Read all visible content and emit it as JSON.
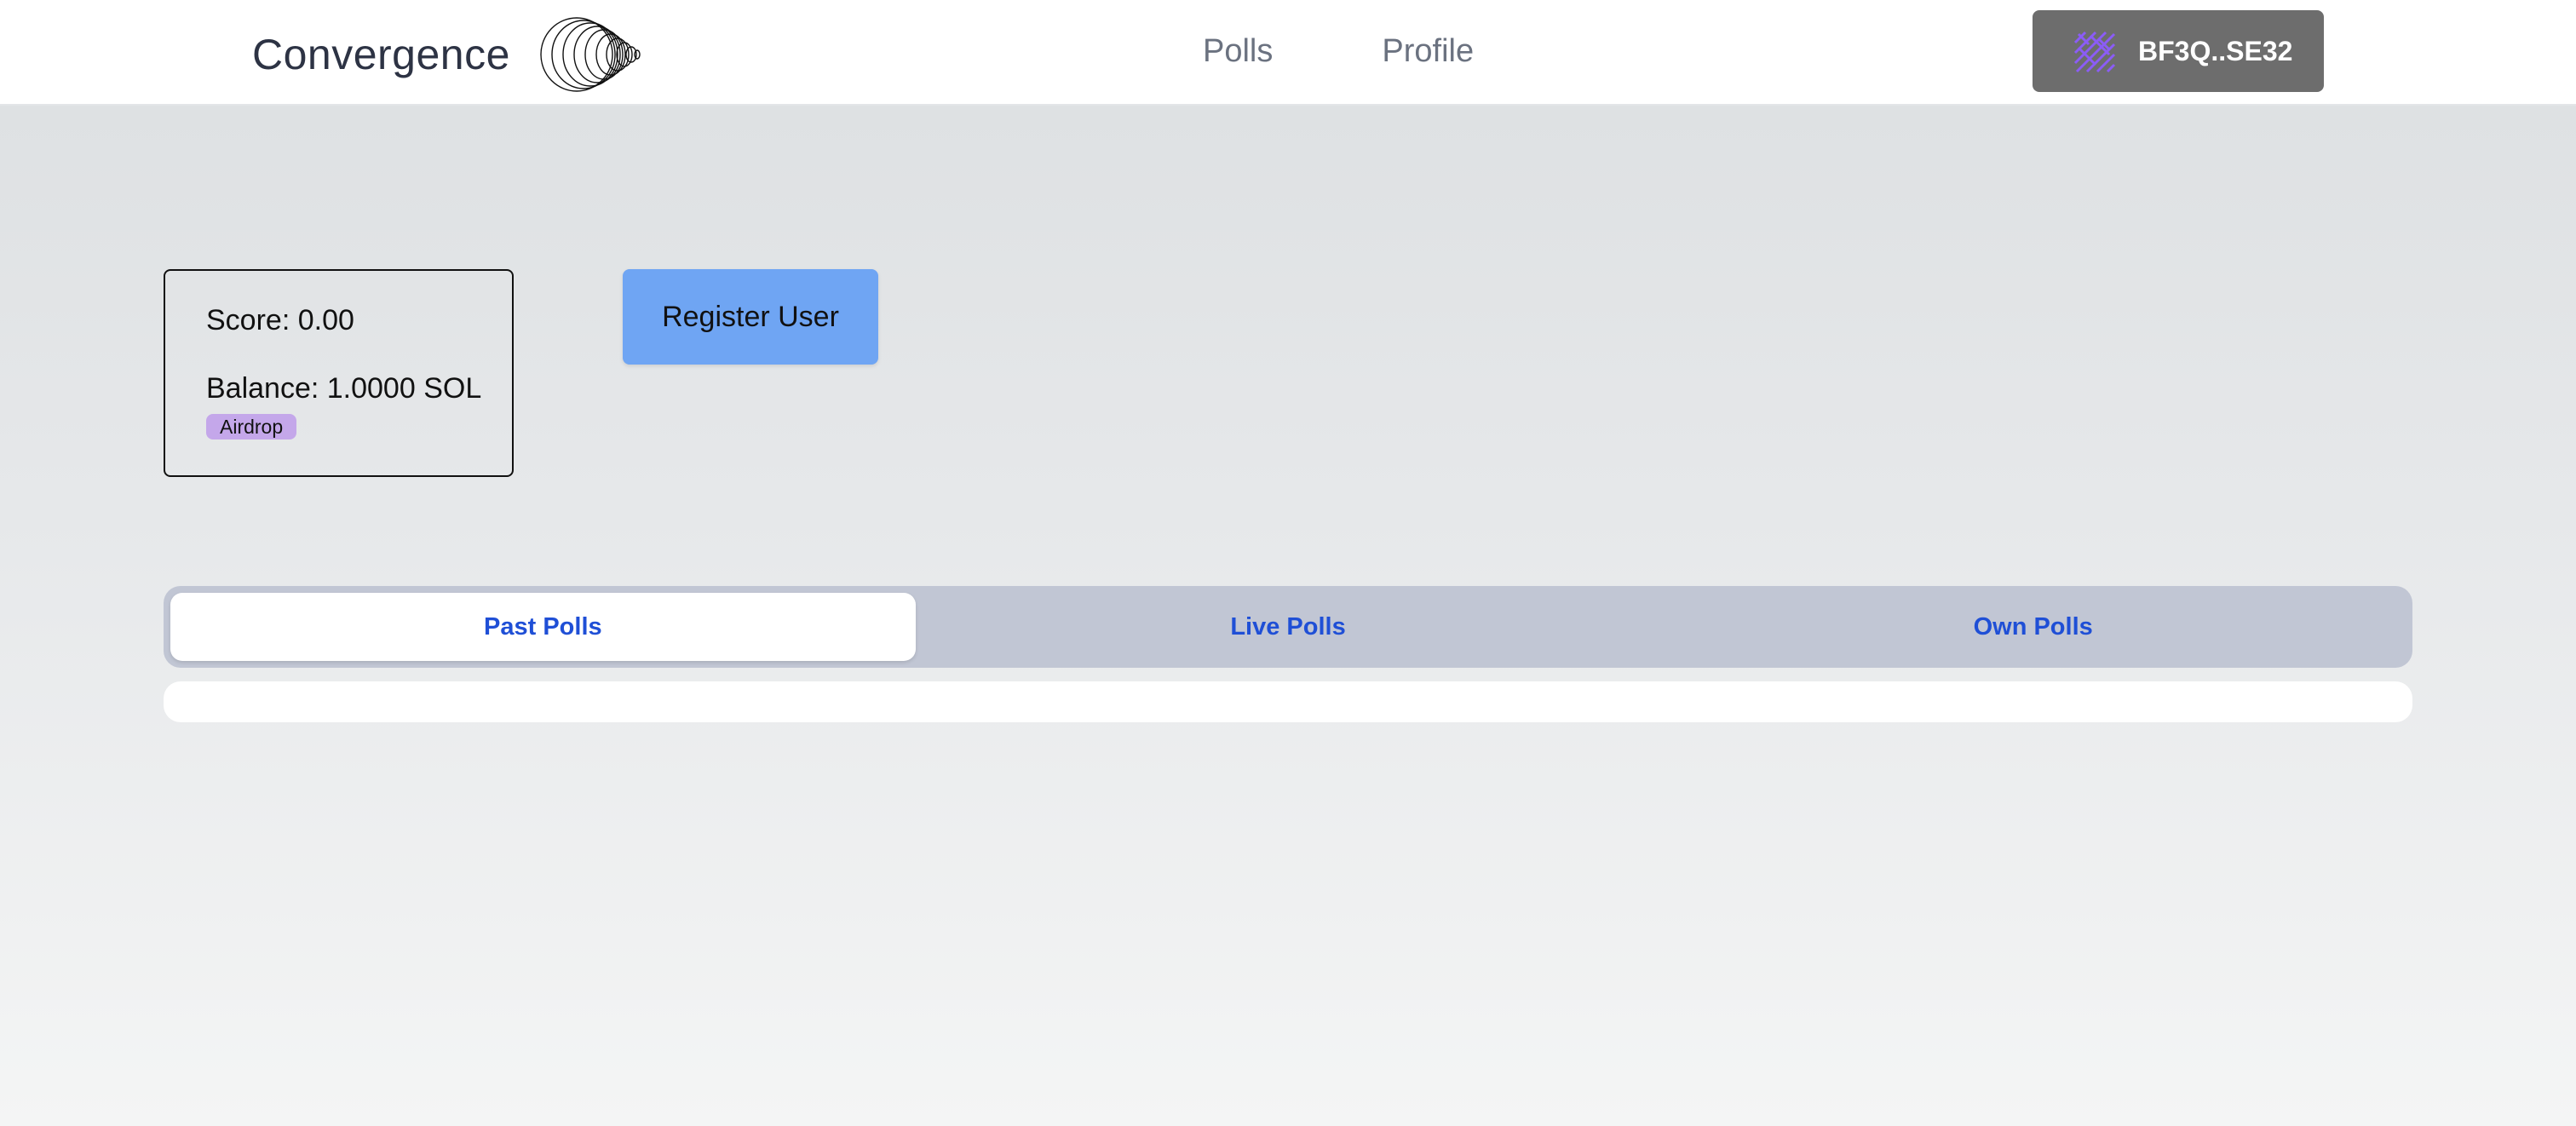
{
  "header": {
    "brand_name": "Convergence",
    "logo_icon": "concentric-rings-logo-icon",
    "nav": [
      {
        "label": "Polls"
      },
      {
        "label": "Profile"
      }
    ],
    "wallet": {
      "label": "BF3Q..SE32",
      "icon": "wallet-identicon-icon",
      "icon_color": "#8b5cf6"
    }
  },
  "stats": {
    "score": "Score: 0.00",
    "balance": "Balance: 1.0000 SOL",
    "airdrop_label": "Airdrop"
  },
  "actions": {
    "register_label": "Register User"
  },
  "tabs": [
    {
      "label": "Past Polls",
      "active": true
    },
    {
      "label": "Live Polls",
      "active": false
    },
    {
      "label": "Own Polls",
      "active": false
    }
  ],
  "colors": {
    "accent_blue": "#6fa5f3",
    "tab_text": "#1f4fd6",
    "badge": "#c4a7ea",
    "wallet_bg": "#6d6d6d"
  }
}
